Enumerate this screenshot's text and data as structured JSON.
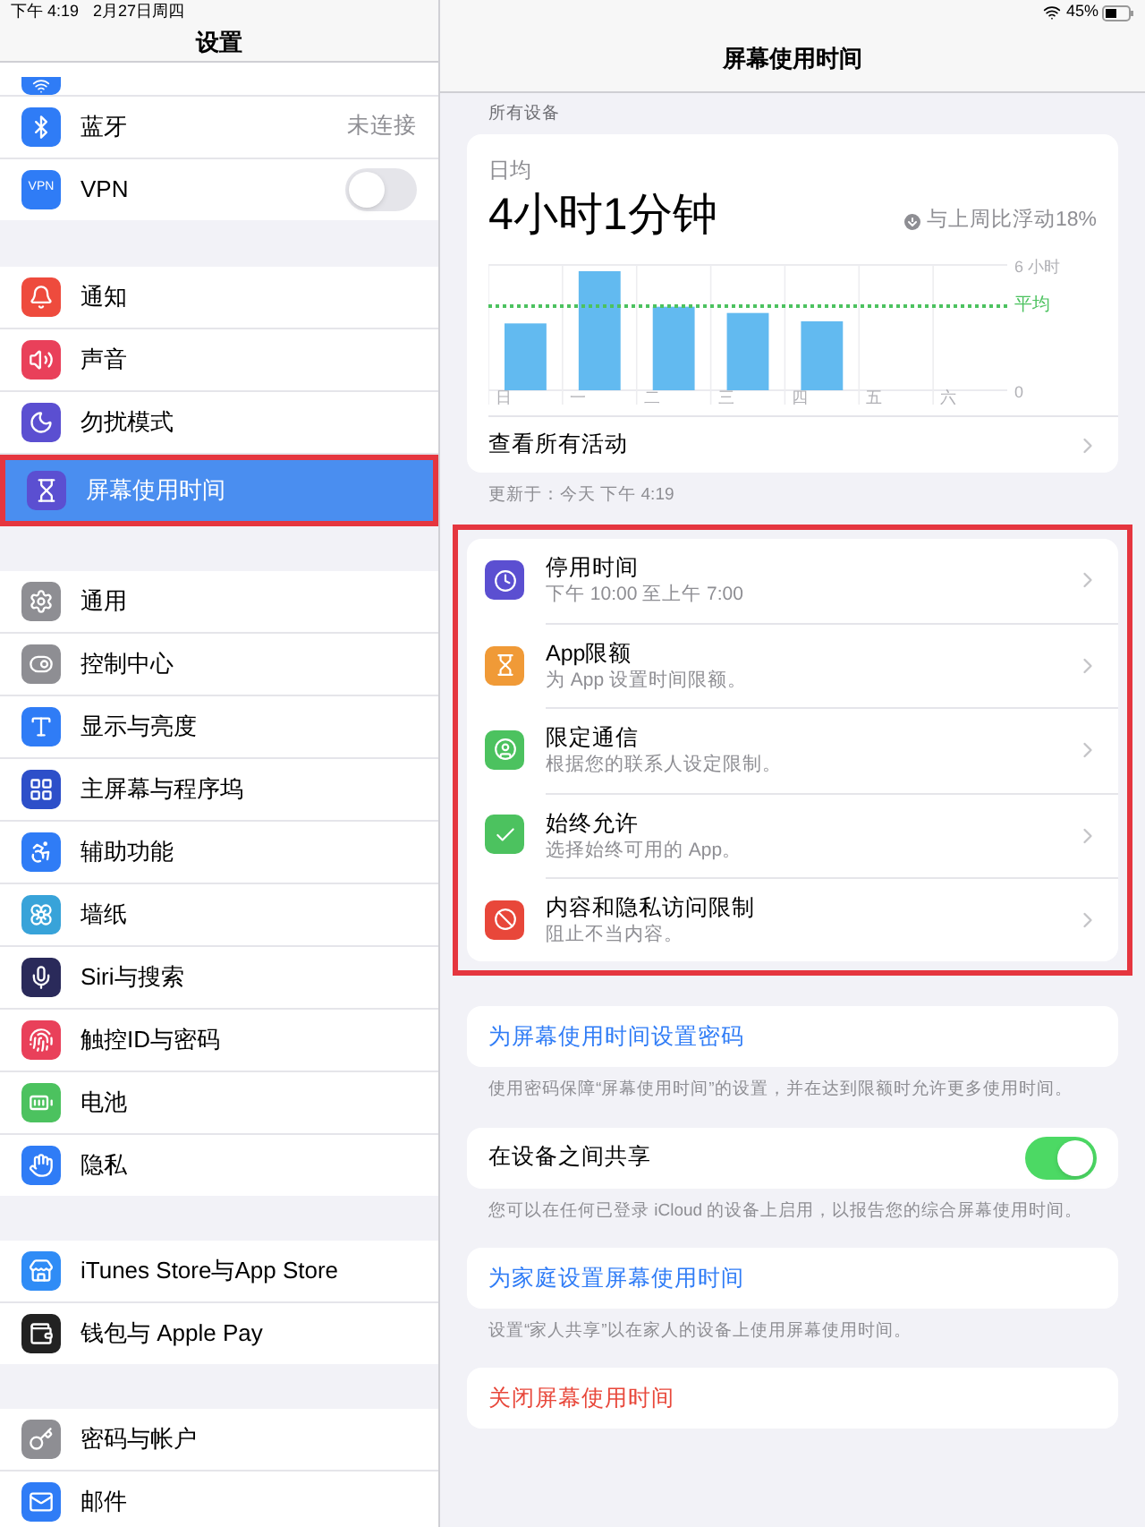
{
  "status_bar": {
    "time": "下午 4:19",
    "date": "2月27日周四",
    "battery": "45%"
  },
  "sidebar": {
    "title": "设置",
    "groups": [
      {
        "items": [
          {
            "kind": "partial",
            "selected": false
          },
          {
            "kind": "value",
            "label": "蓝牙",
            "value": "未连接",
            "selected": false
          },
          {
            "kind": "toggle",
            "label": "VPN",
            "icon_text": "VPN",
            "on": false,
            "selected": false
          }
        ]
      },
      {
        "items": [
          {
            "kind": "plain",
            "label": "通知",
            "selected": false
          },
          {
            "kind": "plain",
            "label": "声音",
            "selected": false
          },
          {
            "kind": "plain",
            "label": "勿扰模式",
            "selected": false
          },
          {
            "kind": "plain",
            "label": "屏幕使用时间",
            "selected": true,
            "highlighted": true
          }
        ]
      },
      {
        "items": [
          {
            "kind": "plain",
            "label": "通用",
            "selected": false
          },
          {
            "kind": "plain",
            "label": "控制中心",
            "selected": false
          },
          {
            "kind": "plain",
            "label": "显示与亮度",
            "selected": false
          },
          {
            "kind": "plain",
            "label": "主屏幕与程序坞",
            "selected": false
          },
          {
            "kind": "plain",
            "label": "辅助功能",
            "selected": false
          },
          {
            "kind": "plain",
            "label": "墙纸",
            "selected": false
          },
          {
            "kind": "plain",
            "label": "Siri与搜索",
            "selected": false
          },
          {
            "kind": "plain",
            "label": "触控ID与密码",
            "selected": false
          },
          {
            "kind": "plain",
            "label": "电池",
            "selected": false
          },
          {
            "kind": "plain",
            "label": "隐私",
            "selected": false
          }
        ]
      },
      {
        "items": [
          {
            "kind": "plain",
            "label": "iTunes Store与App Store",
            "selected": false
          },
          {
            "kind": "plain",
            "label": "钱包与 Apple Pay",
            "selected": false
          }
        ]
      },
      {
        "items": [
          {
            "kind": "plain",
            "label": "密码与帐户",
            "selected": false
          },
          {
            "kind": "plain",
            "label": "邮件",
            "selected": false
          }
        ]
      }
    ]
  },
  "detail": {
    "title": "屏幕使用时间",
    "section_label": "所有设备",
    "summary": {
      "label": "日均",
      "value": "4小时1分钟",
      "change": "与上周比浮动18%",
      "chart_data": {
        "type": "bar",
        "categories": [
          "日",
          "一",
          "二",
          "三",
          "四",
          "五",
          "六"
        ],
        "values": [
          3.2,
          5.7,
          4.0,
          3.7,
          3.3,
          null,
          null
        ],
        "ylim": [
          0,
          6
        ],
        "yticks": [
          {
            "value": 6,
            "label": "6 小时"
          },
          {
            "value": 0,
            "label": "0"
          }
        ]
      },
      "average_label": "平均",
      "link": "查看所有活动"
    },
    "updated": "更新于：今天 下午 4:19",
    "limits": {
      "highlighted": true,
      "items": [
        {
          "title": "停用时间",
          "subtitle": "下午 10:00 至上午 7:00"
        },
        {
          "title": "App限额",
          "subtitle": "为 App 设置时间限额。"
        },
        {
          "title": "限定通信",
          "subtitle": "根据您的联系人设定限制。"
        },
        {
          "title": "始终允许",
          "subtitle": "选择始终可用的 App。"
        },
        {
          "title": "内容和隐私访问限制",
          "subtitle": "阻止不当内容。"
        }
      ]
    },
    "options": [
      {
        "kind": "link",
        "label": "为屏幕使用时间设置密码",
        "footnote": "使用密码保障“屏幕使用时间”的设置，并在达到限额时允许更多使用时间。"
      },
      {
        "kind": "toggle",
        "label": "在设备之间共享",
        "on": true,
        "footnote": "您可以在任何已登录 iCloud 的设备上启用，以报告您的综合屏幕使用时间。"
      },
      {
        "kind": "link",
        "label": "为家庭设置屏幕使用时间",
        "footnote": "设置“家人共享”以在家人的设备上使用屏幕使用时间。"
      },
      {
        "kind": "destructive",
        "label": "关闭屏幕使用时间"
      }
    ]
  }
}
